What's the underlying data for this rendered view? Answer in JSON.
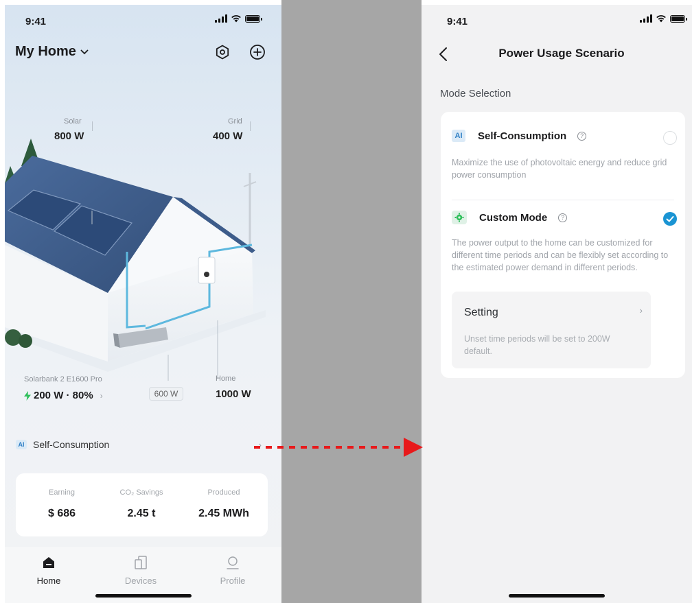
{
  "left_screen": {
    "status_time": "9:41",
    "header": {
      "title": "My Home"
    },
    "flows": {
      "solar": {
        "label": "Solar",
        "value": "800 W"
      },
      "grid": {
        "label": "Grid",
        "value": "400 W"
      },
      "device": {
        "label": "Solarbank 2 E1600 Pro",
        "value": "200 W · 80%"
      },
      "middle": {
        "value": "600 W"
      },
      "home": {
        "label": "Home",
        "value": "1000 W"
      }
    },
    "mode": {
      "badge": "AI",
      "label": "Self-Consumption"
    },
    "stats": [
      {
        "label": "Earning",
        "value": "$ 686"
      },
      {
        "label": "CO₂ Savings",
        "value": "2.45 t"
      },
      {
        "label": "Produced",
        "value": "2.45 MWh"
      }
    ],
    "tabs": [
      {
        "label": "Home",
        "icon": "home-icon",
        "active": true
      },
      {
        "label": "Devices",
        "icon": "devices-icon",
        "active": false
      },
      {
        "label": "Profile",
        "icon": "profile-icon",
        "active": false
      }
    ]
  },
  "right_screen": {
    "status_time": "9:41",
    "title": "Power Usage Scenario",
    "section_label": "Mode Selection",
    "options": [
      {
        "badge": "AI",
        "name": "Self-Consumption",
        "description": "Maximize the use of photovoltaic energy and reduce grid power consumption",
        "selected": false
      },
      {
        "badge": "gear",
        "name": "Custom Mode",
        "description": "The power output to the home can be customized for different time periods and can be flexibly set according to the estimated power demand in different periods.",
        "selected": true
      }
    ],
    "setting": {
      "title": "Setting",
      "note": "Unset time periods will be set to 200W default."
    }
  },
  "colors": {
    "accent_blue": "#1a94d3",
    "energy_green": "#2fbf5b",
    "arrow_red": "#e8191b"
  }
}
